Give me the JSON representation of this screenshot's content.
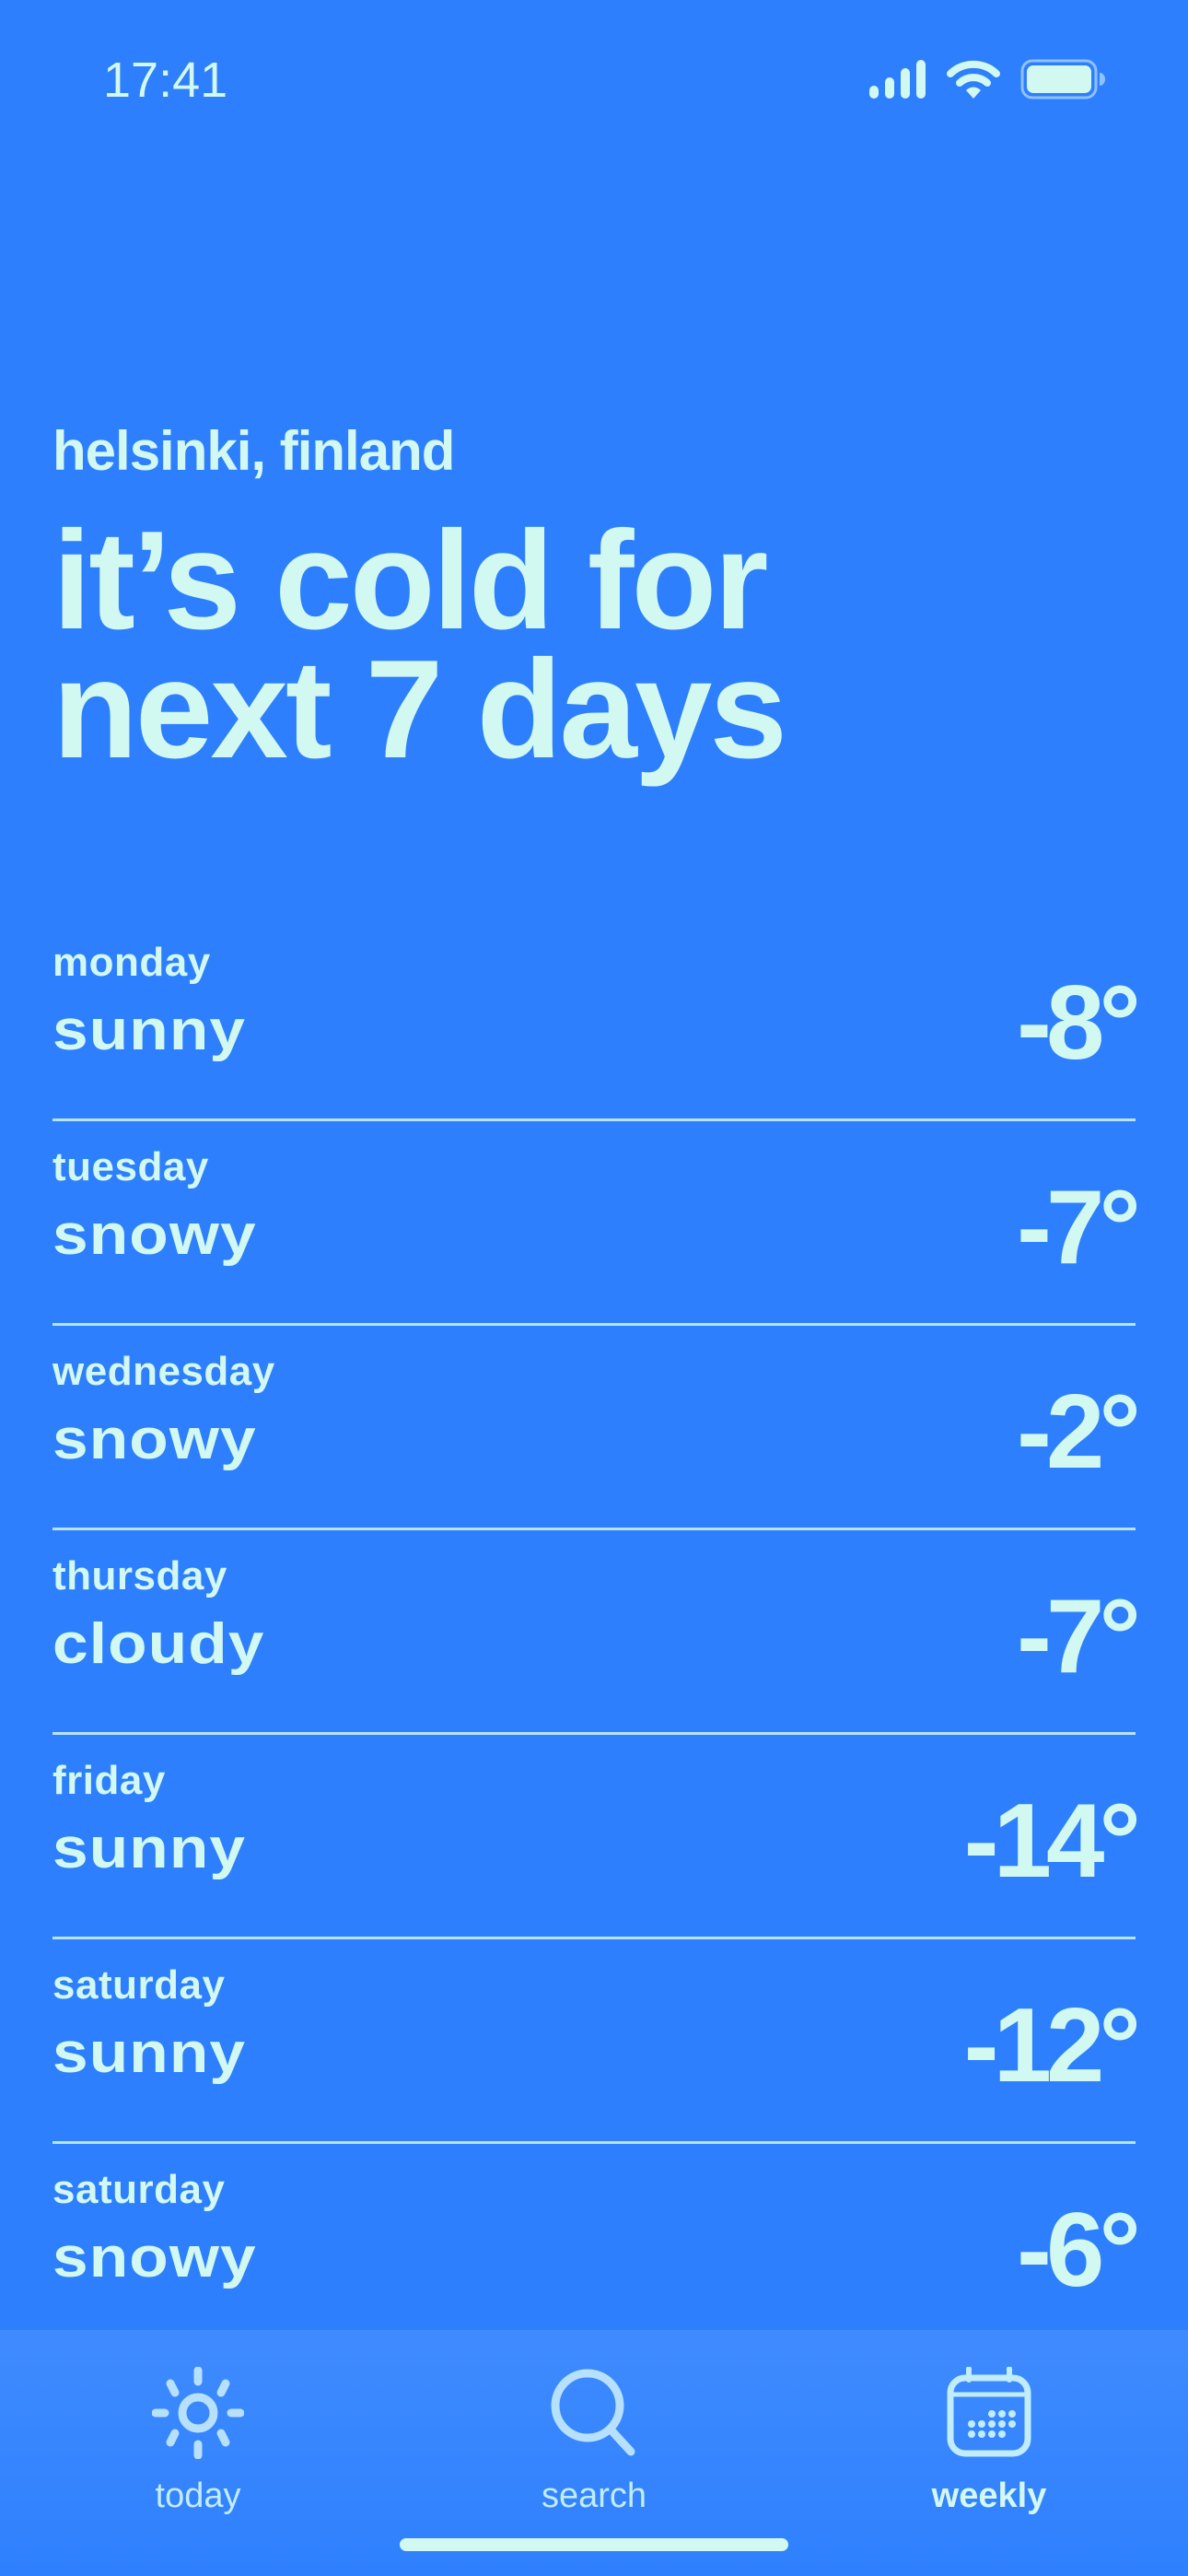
{
  "status_bar": {
    "time": "17:41",
    "icons": [
      "cellular-signal-icon",
      "wifi-icon",
      "battery-icon"
    ]
  },
  "header": {
    "location": "helsinki, finland",
    "headline_line1": "it’s cold for",
    "headline_line2": "next 7 days"
  },
  "forecast": [
    {
      "day": "monday",
      "condition": "sunny",
      "temp": "-8°"
    },
    {
      "day": "tuesday",
      "condition": "snowy",
      "temp": "-7°"
    },
    {
      "day": "wednesday",
      "condition": "snowy",
      "temp": "-2°"
    },
    {
      "day": "thursday",
      "condition": "cloudy",
      "temp": "-7°"
    },
    {
      "day": "friday",
      "condition": "sunny",
      "temp": "-14°"
    },
    {
      "day": "saturday",
      "condition": "sunny",
      "temp": "-12°"
    },
    {
      "day": "saturday",
      "condition": "snowy",
      "temp": "-6°"
    }
  ],
  "tab_bar": {
    "tabs": [
      {
        "label": "today",
        "icon": "sun-icon",
        "active": false
      },
      {
        "label": "search",
        "icon": "search-icon",
        "active": false
      },
      {
        "label": "weekly",
        "icon": "calendar-icon",
        "active": true
      }
    ]
  },
  "colors": {
    "background": "#2d7ffe",
    "text": "#d2f8f2",
    "divider": "#b8e4fb",
    "tab_icon": "#b6e0fb"
  }
}
